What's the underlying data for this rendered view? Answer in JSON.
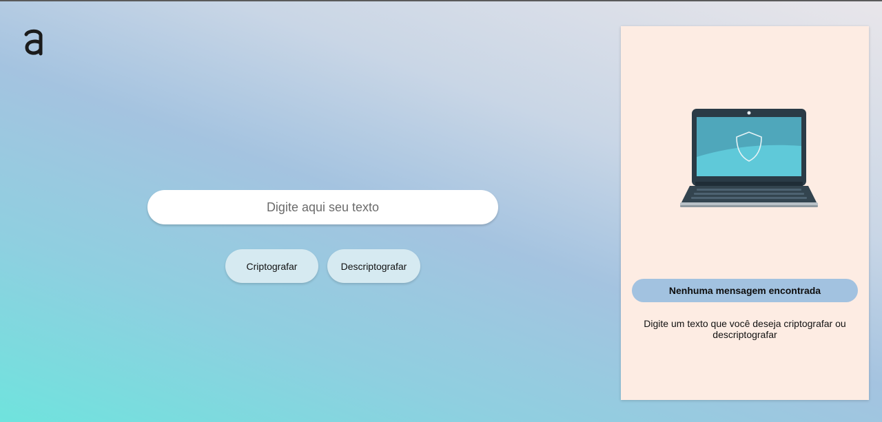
{
  "header": {
    "logo_icon": "alura-logo-icon"
  },
  "input": {
    "placeholder": "Digite aqui seu texto",
    "value": ""
  },
  "actions": {
    "encrypt_label": "Criptografar",
    "decrypt_label": "Descriptografar"
  },
  "output_panel": {
    "illustration_icon": "laptop-shield-icon",
    "title": "Nenhuma mensagem encontrada",
    "description": "Digite um texto que você deseja criptografar ou descriptografar"
  },
  "colors": {
    "button_bg": "#d6eaf1",
    "panel_bg": "#fdece3",
    "title_badge_bg": "#a2c2e0"
  }
}
